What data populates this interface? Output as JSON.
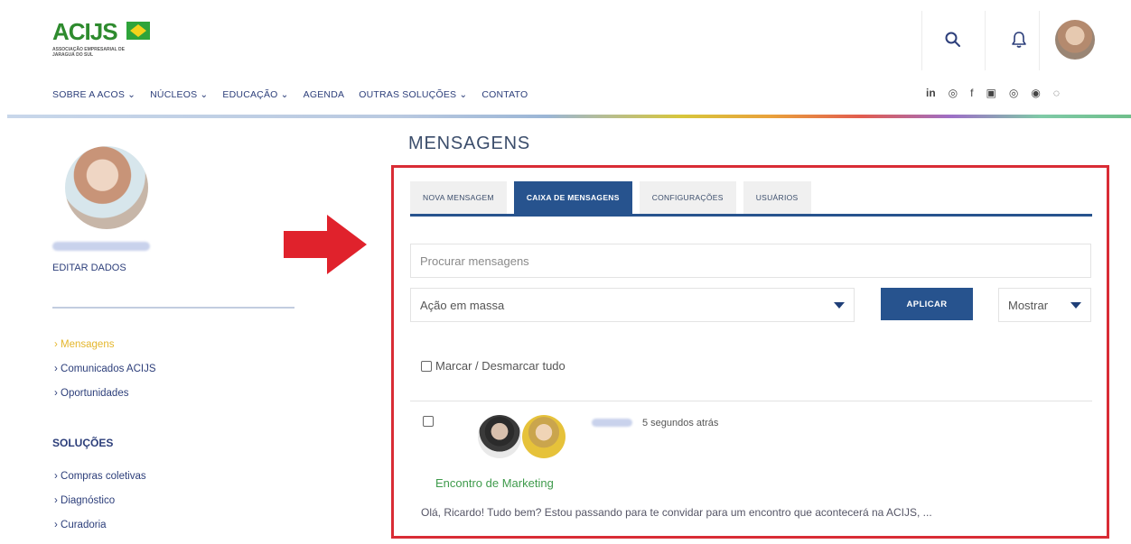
{
  "header": {
    "logo_text": "ACIJS",
    "logo_subtitle": "ASSOCIAÇÃO EMPRESARIAL DE JARAGUÁ DO SUL",
    "search_icon": "search-icon",
    "bell_icon": "bell-icon"
  },
  "nav": {
    "items": [
      "SOBRE A ACOS ⌄",
      "NÚCLEOS ⌄",
      "EDUCAÇÃO ⌄",
      "AGENDA",
      "OUTRAS SOLUÇÕES ⌄",
      "CONTATO"
    ],
    "social": [
      "in",
      "◎",
      "f",
      "▣",
      "◎",
      "◉",
      "◌"
    ]
  },
  "sidebar": {
    "edit_label": "EDITAR DADOS",
    "menu": [
      "› Mensagens",
      "› Comunicados ACIJS",
      "› Oportunidades"
    ],
    "solutions_heading": "SOLUÇÕES",
    "solutions": [
      "› Compras coletivas",
      "› Diagnóstico",
      "› Curadoria"
    ]
  },
  "main": {
    "title": "MENSAGENS",
    "tabs": [
      {
        "label": "NOVA MENSAGEM"
      },
      {
        "label": "CAIXA DE MENSAGENS"
      },
      {
        "label": "CONFIGURAÇÕES"
      },
      {
        "label": "USUÁRIOS"
      }
    ],
    "search_placeholder": "Procurar mensagens",
    "bulk_action": "Ação em massa",
    "apply_label": "APLICAR",
    "show_label": "Mostrar",
    "mark_all_label": "Marcar / Desmarcar tudo",
    "message": {
      "time": "5 segundos atrás",
      "subject": "Encontro de Marketing",
      "preview": "Olá, Ricardo! Tudo bem? Estou passando para te convidar para um encontro que acontecerá na ACIJS, ..."
    }
  },
  "colors": {
    "primary": "#27538e",
    "highlight": "#d92c35",
    "active_link": "#e4b62c",
    "subject": "#3f9b4c"
  }
}
